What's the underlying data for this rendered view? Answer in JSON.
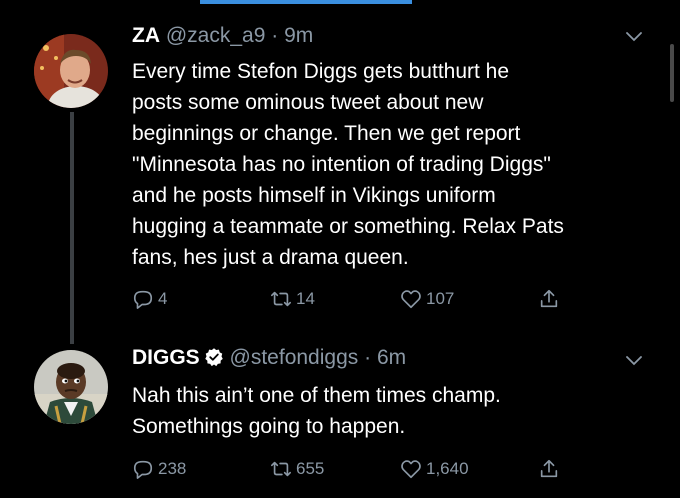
{
  "colors": {
    "background": "#000000",
    "text": "#ffffff",
    "secondary": "#8b98a5",
    "thread_line": "#3b3f43",
    "verified": "#ffffff",
    "progress": "#3a8fe0"
  },
  "tweets": [
    {
      "display_name": "ZA",
      "handle": "@zack_a9",
      "separator": "·",
      "time": "9m",
      "verified": false,
      "text": "Every time Stefon Diggs gets butthurt he\nposts some ominous tweet about new\nbeginnings or change. Then we get report\n\"Minnesota has no intention of trading Diggs\"\nand he posts himself in Vikings uniform\nhugging a teammate or something. Relax Pats\nfans, hes just a drama queen.",
      "replies": "4",
      "retweets": "14",
      "likes": "107",
      "icons": {
        "reply": "reply-icon",
        "retweet": "retweet-icon",
        "like": "heart-icon",
        "share": "share-icon",
        "menu": "chevron-down-icon"
      }
    },
    {
      "display_name": "DIGGS",
      "handle": "@stefondiggs",
      "separator": "·",
      "time": "6m",
      "verified": true,
      "text": "Nah this ain’t one of them times champ.\nSomethings going to happen.",
      "replies": "238",
      "retweets": "655",
      "likes": "1,640",
      "icons": {
        "reply": "reply-icon",
        "retweet": "retweet-icon",
        "like": "heart-icon",
        "share": "share-icon",
        "menu": "chevron-down-icon"
      }
    }
  ]
}
